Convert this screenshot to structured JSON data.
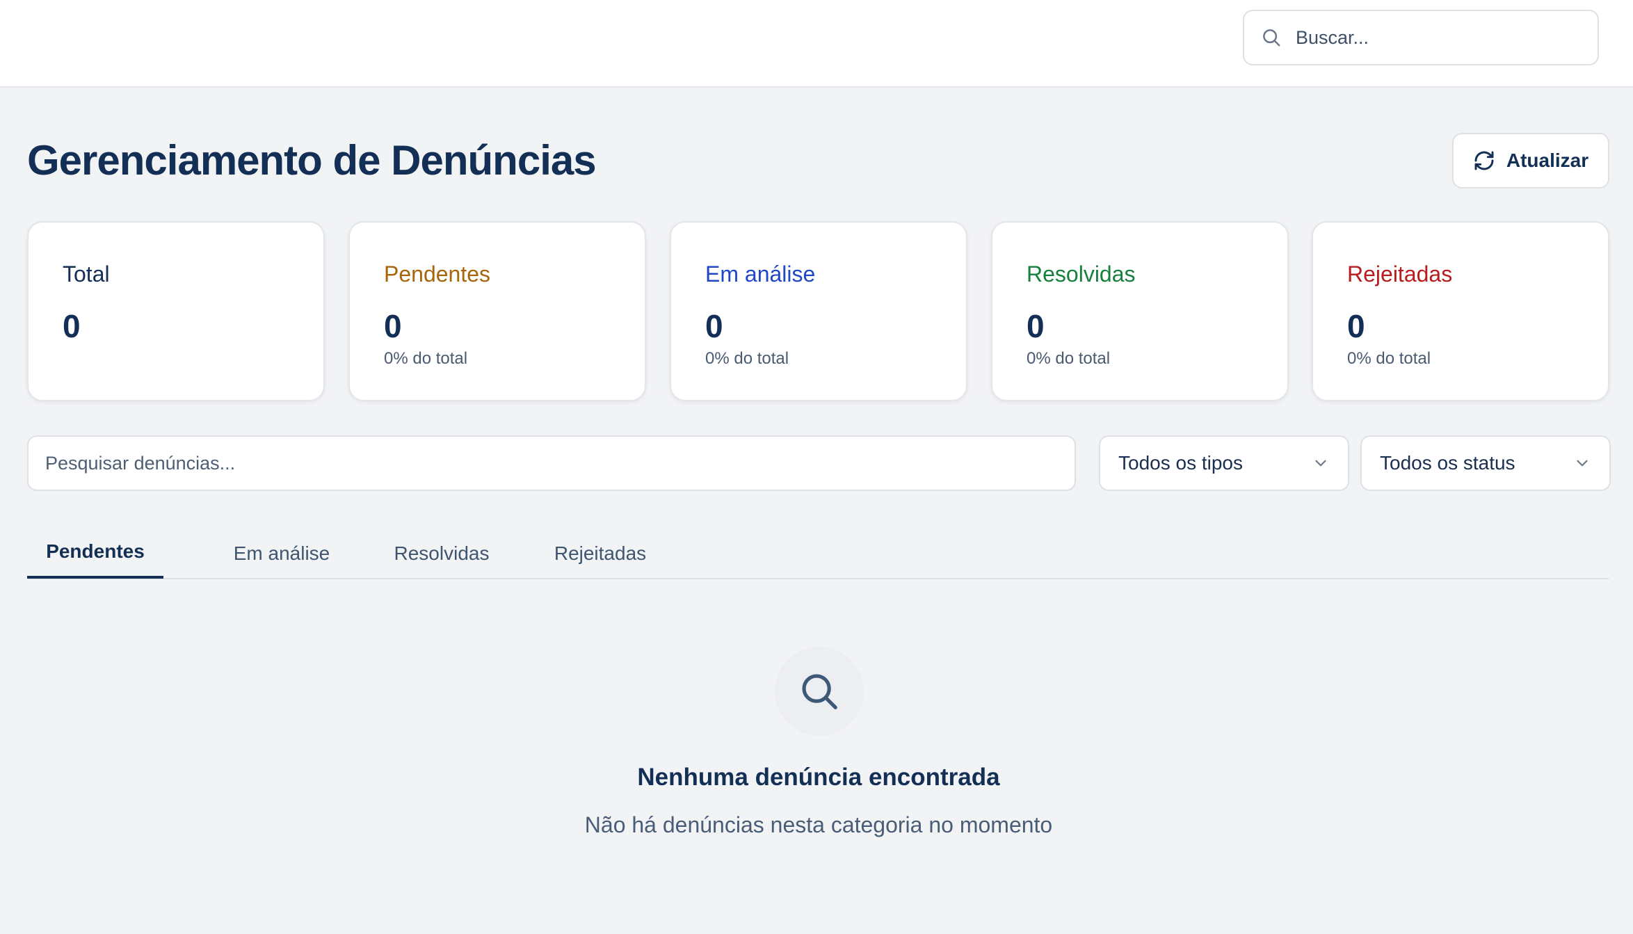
{
  "topbar": {
    "search_placeholder": "Buscar...",
    "search_icon": "search-icon"
  },
  "header": {
    "title": "Gerenciamento de Denúncias",
    "refresh_label": "Atualizar",
    "refresh_icon": "refresh-icon"
  },
  "stats": [
    {
      "label": "Total",
      "value": "0",
      "sub": "",
      "color": "#132f55"
    },
    {
      "label": "Pendentes",
      "value": "0",
      "sub": "0% do total",
      "color": "#a8650a"
    },
    {
      "label": "Em análise",
      "value": "0",
      "sub": "0% do total",
      "color": "#1f48c8"
    },
    {
      "label": "Resolvidas",
      "value": "0",
      "sub": "0% do total",
      "color": "#16803c"
    },
    {
      "label": "Rejeitadas",
      "value": "0",
      "sub": "0% do total",
      "color": "#b81c1c"
    }
  ],
  "filters": {
    "search_placeholder": "Pesquisar denúncias...",
    "type_selected": "Todos os tipos",
    "status_selected": "Todos os status"
  },
  "tabs": [
    {
      "label": "Pendentes",
      "active": true
    },
    {
      "label": "Em análise",
      "active": false
    },
    {
      "label": "Resolvidas",
      "active": false
    },
    {
      "label": "Rejeitadas",
      "active": false
    }
  ],
  "empty_state": {
    "icon": "search-icon",
    "title": "Nenhuma denúncia encontrada",
    "subtitle": "Não há denúncias nesta categoria no momento"
  }
}
